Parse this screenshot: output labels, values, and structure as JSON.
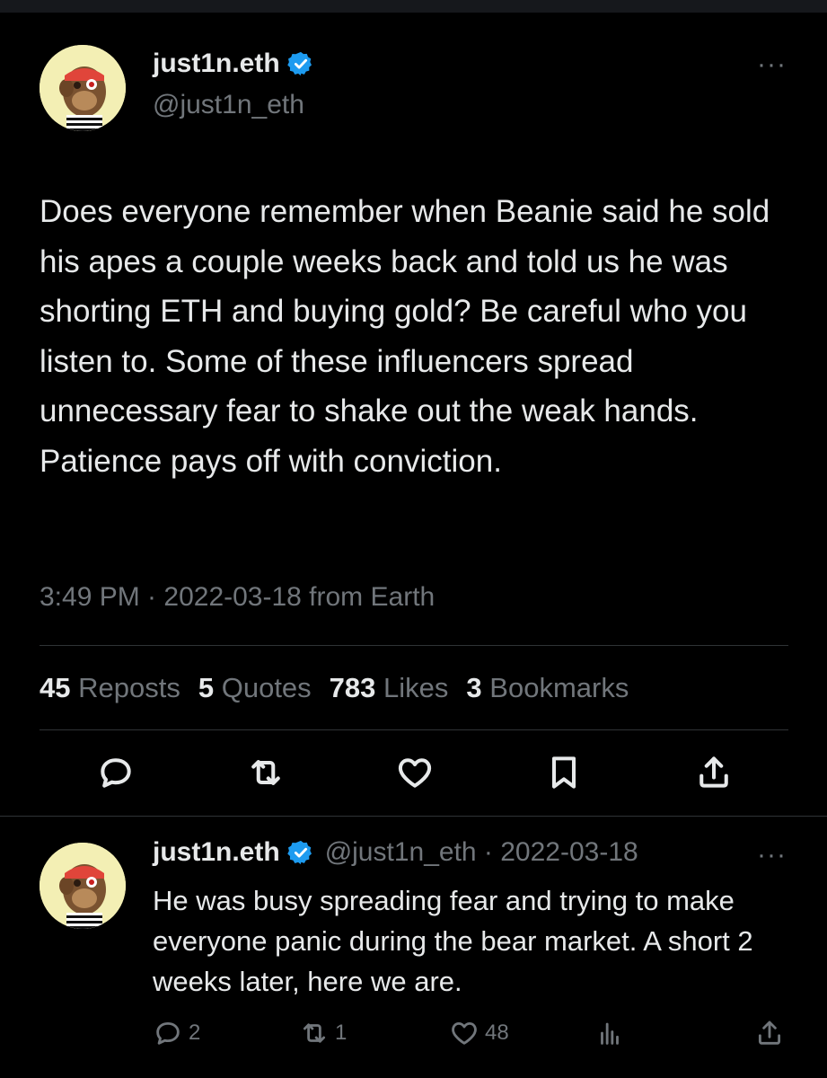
{
  "tweet": {
    "display_name": "just1n.eth",
    "handle": "@just1n_eth",
    "text": "Does everyone remember when Beanie said he sold his apes a couple weeks back and told us he was shorting ETH and buying gold? Be careful who you listen to. Some of these influencers spread unnecessary fear to shake out the weak hands. Patience pays off with conviction.",
    "meta": "3:49 PM · 2022-03-18 from Earth",
    "stats": [
      {
        "count": "45",
        "label": "Reposts"
      },
      {
        "count": "5",
        "label": "Quotes"
      },
      {
        "count": "783",
        "label": "Likes"
      },
      {
        "count": "3",
        "label": "Bookmarks"
      }
    ],
    "actions": [
      "reply-icon",
      "repost-icon",
      "like-icon",
      "bookmark-icon",
      "share-icon"
    ]
  },
  "reply": {
    "display_name": "just1n.eth",
    "handle_date": "@just1n_eth · 2022-03-18",
    "text": "He was busy spreading fear and trying to make everyone panic during the bear market. A short 2 weeks later, here we are.",
    "reply_count": "2",
    "repost_count": "1",
    "like_count": "48"
  },
  "colors": {
    "background": "#000000",
    "text": "#e7e9ea",
    "muted": "#71767b",
    "divider": "#2f3336",
    "verified": "#1d9bf0"
  }
}
